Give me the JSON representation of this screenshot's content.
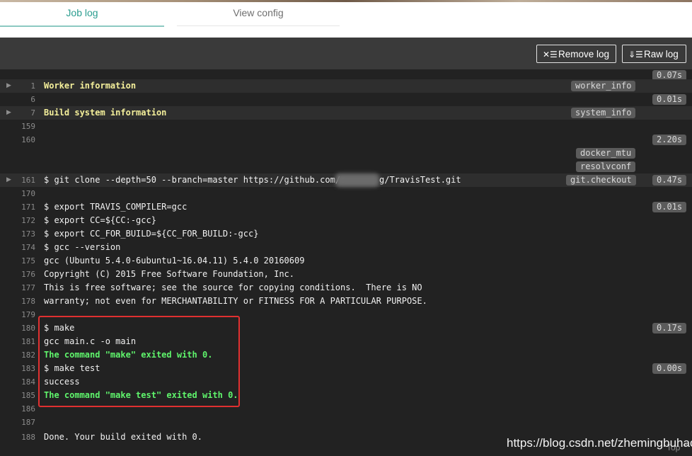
{
  "tabs": {
    "job_log": "Job log",
    "view_config": "View config"
  },
  "toolbar": {
    "remove_log": "Remove log",
    "raw_log": "Raw log",
    "remove_icon": "remove-log-icon",
    "raw_icon": "raw-log-icon"
  },
  "colors": {
    "accent": "#2a9d8f",
    "fold_title": "#f5f09b",
    "success": "#5ff56c",
    "highlight": "#e03030"
  },
  "log": {
    "r1": {
      "num": "1",
      "text": "Worker information",
      "tag": "worker_info",
      "time": "0.07s"
    },
    "r6": {
      "num": "6",
      "time": "0.01s"
    },
    "r7": {
      "num": "7",
      "text": "Build system information",
      "tag": "system_info"
    },
    "r159": {
      "num": "159"
    },
    "r160": {
      "num": "160",
      "time": "2.20s",
      "tag1": "docker_mtu",
      "tag2": "resolvconf"
    },
    "r161": {
      "num": "161",
      "text_a": "$ git clone --depth=50 --branch=master https://github.com/s",
      "text_b": "g/TravisTest.git",
      "tag": "git.checkout",
      "time": "0.47s"
    },
    "r170": {
      "num": "170"
    },
    "r171": {
      "num": "171",
      "text": "$ export TRAVIS_COMPILER=gcc",
      "time": "0.01s"
    },
    "r172": {
      "num": "172",
      "text": "$ export CC=${CC:-gcc}"
    },
    "r173": {
      "num": "173",
      "text": "$ export CC_FOR_BUILD=${CC_FOR_BUILD:-gcc}"
    },
    "r174": {
      "num": "174",
      "text": "$ gcc --version"
    },
    "r175": {
      "num": "175",
      "text": "gcc (Ubuntu 5.4.0-6ubuntu1~16.04.11) 5.4.0 20160609"
    },
    "r176": {
      "num": "176",
      "text": "Copyright (C) 2015 Free Software Foundation, Inc."
    },
    "r177": {
      "num": "177",
      "text": "This is free software; see the source for copying conditions.  There is NO"
    },
    "r178": {
      "num": "178",
      "text": "warranty; not even for MERCHANTABILITY or FITNESS FOR A PARTICULAR PURPOSE."
    },
    "r179": {
      "num": "179"
    },
    "r180": {
      "num": "180",
      "text": "$ make",
      "time": "0.17s"
    },
    "r181": {
      "num": "181",
      "text": "gcc main.c -o main"
    },
    "r182": {
      "num": "182",
      "text": "The command \"make\" exited with 0."
    },
    "r183": {
      "num": "183",
      "text": "$ make test",
      "time": "0.00s"
    },
    "r184": {
      "num": "184",
      "text": "success"
    },
    "r185": {
      "num": "185",
      "text": "The command \"make test\" exited with 0."
    },
    "r186": {
      "num": "186"
    },
    "r187": {
      "num": "187"
    },
    "r188": {
      "num": "188",
      "text": "Done. Your build exited with 0."
    }
  },
  "watermark": "https://blog.csdn.net/zhemingbuhao",
  "top_link": "Top"
}
